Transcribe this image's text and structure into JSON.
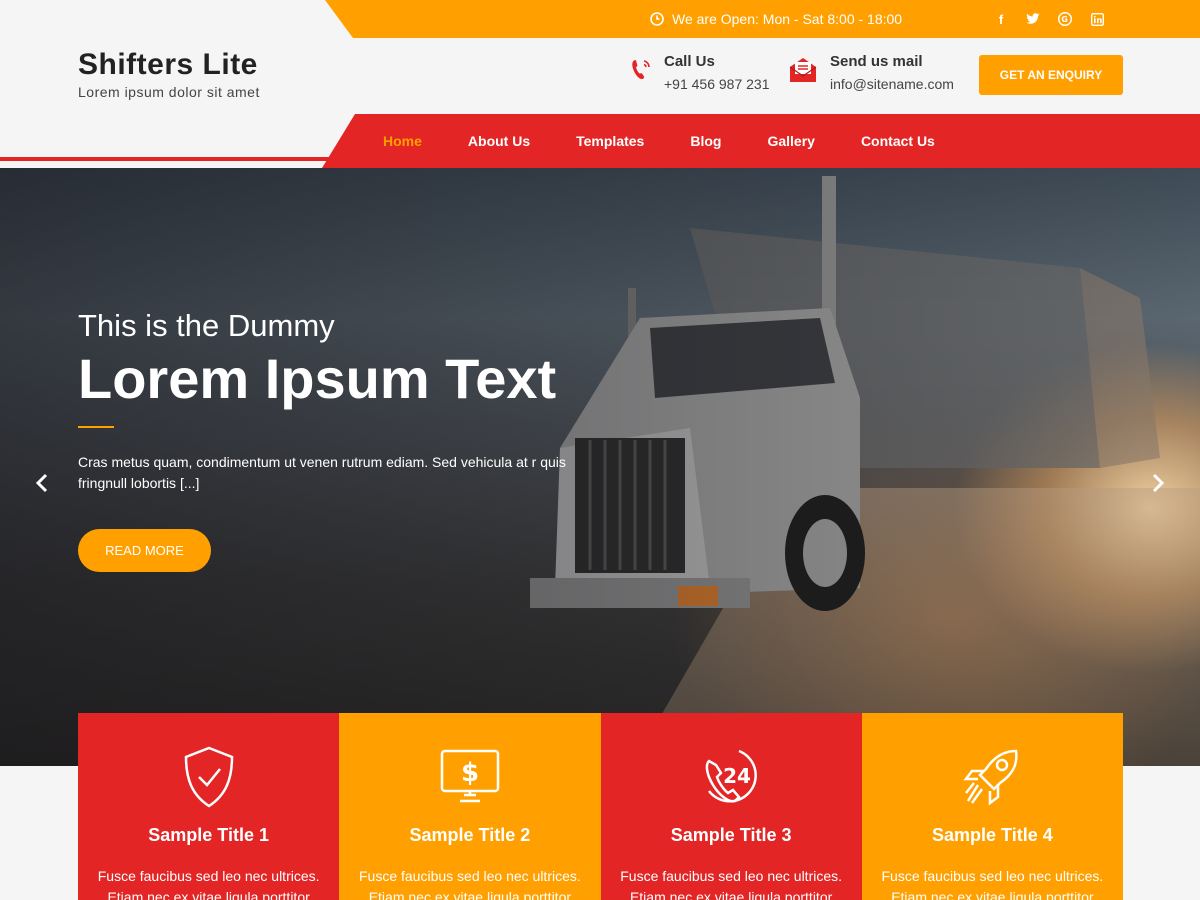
{
  "topbar": {
    "hours": "We are Open: Mon - Sat 8:00 - 18:00",
    "social": [
      "facebook-icon",
      "twitter-icon",
      "google-plus-icon",
      "linkedin-icon"
    ]
  },
  "brand": {
    "title": "Shifters Lite",
    "tagline": "Lorem ipsum dolor sit amet"
  },
  "contact": {
    "call_title": "Call Us",
    "call_value": "+91 456 987 231",
    "mail_title": "Send us mail",
    "mail_value": "info@sitename.com",
    "enquiry_label": "GET AN ENQUIRY"
  },
  "nav": {
    "items": [
      "Home",
      "About Us",
      "Templates",
      "Blog",
      "Gallery",
      "Contact Us"
    ],
    "active": "Home"
  },
  "hero": {
    "subtitle": "This is the Dummy",
    "title": "Lorem Ipsum Text",
    "text": "Cras metus quam, condimentum ut venen rutrum ediam. Sed vehicula at r quis fringnull lobortis [...]",
    "button": "READ MORE"
  },
  "features": [
    {
      "title": "Sample Title 1",
      "text": "Fusce faucibus sed leo nec ultrices. Etiam nec ex vitae ligula porttitor",
      "icon": "shield-check-icon"
    },
    {
      "title": "Sample Title 2",
      "text": "Fusce faucibus sed leo nec ultrices. Etiam nec ex vitae ligula porttitor",
      "icon": "dollar-monitor-icon"
    },
    {
      "title": "Sample Title 3",
      "text": "Fusce faucibus sed leo nec ultrices. Etiam nec ex vitae ligula porttitor",
      "icon": "phone-24-icon"
    },
    {
      "title": "Sample Title 4",
      "text": "Fusce faucibus sed leo nec ultrices. Etiam nec ex vitae ligula porttitor",
      "icon": "rocket-icon"
    }
  ],
  "colors": {
    "orange": "#ffa000",
    "red": "#e32525"
  }
}
